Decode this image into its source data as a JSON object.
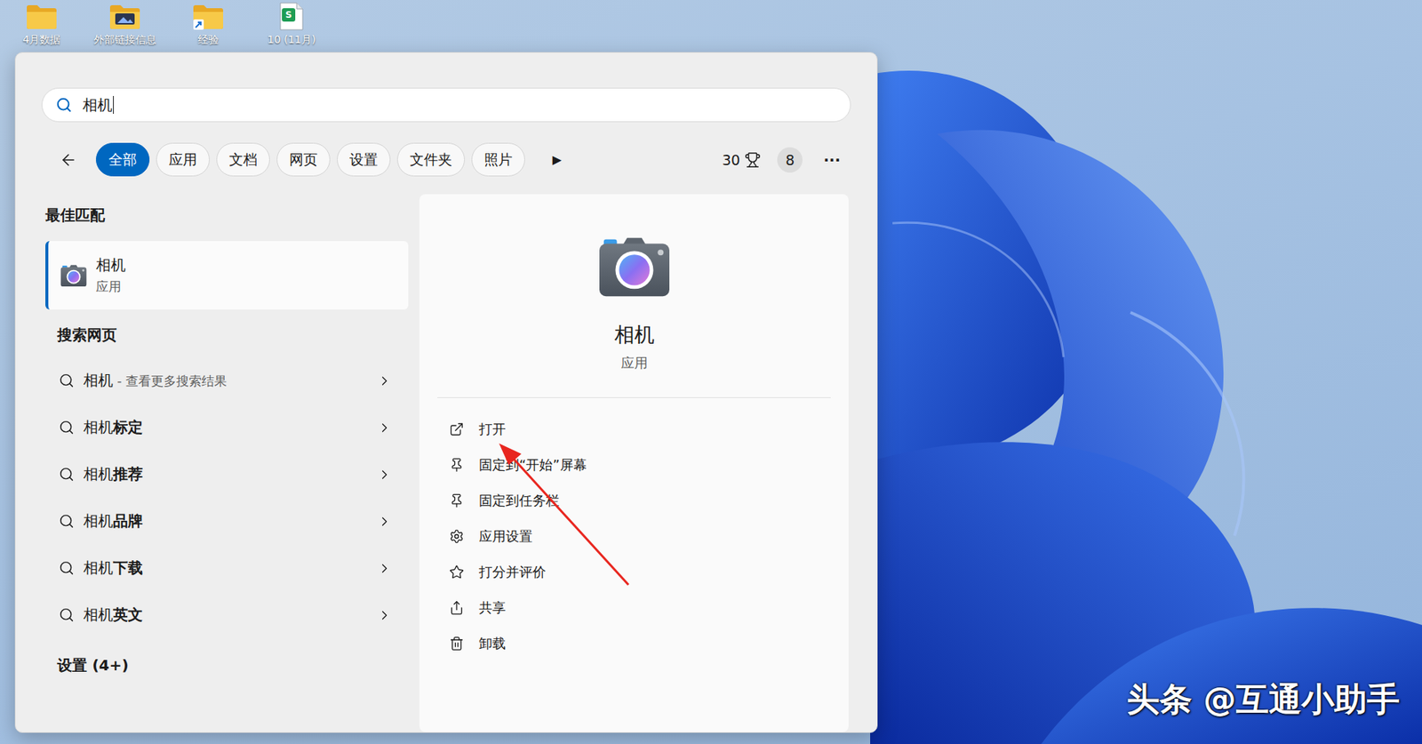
{
  "desktop": {
    "icons": [
      {
        "label": "4月数据",
        "kind": "folder"
      },
      {
        "label": "外部链接信息",
        "kind": "photo-folder"
      },
      {
        "label": "经验",
        "kind": "shortcut-folder"
      },
      {
        "label": "10 (11月)",
        "kind": "sheet",
        "badge": "S"
      }
    ]
  },
  "search": {
    "query": "相机"
  },
  "filters": [
    {
      "label": "全部",
      "selected": true
    },
    {
      "label": "应用",
      "selected": false
    },
    {
      "label": "文档",
      "selected": false
    },
    {
      "label": "网页",
      "selected": false
    },
    {
      "label": "设置",
      "selected": false
    },
    {
      "label": "文件夹",
      "selected": false
    },
    {
      "label": "照片",
      "selected": false
    }
  ],
  "play": "▶",
  "points": "30",
  "badge": "8",
  "more": "···",
  "best_match": {
    "heading": "最佳匹配",
    "title": "相机",
    "subtitle": "应用",
    "selected": true
  },
  "web": {
    "heading": "搜索网页",
    "items": [
      {
        "prefix": "相机",
        "rest": " - 查看更多搜索结果",
        "kind": "more"
      },
      {
        "prefix": "相机",
        "rest": "标定",
        "kind": "suggestion"
      },
      {
        "prefix": "相机",
        "rest": "推荐",
        "kind": "suggestion"
      },
      {
        "prefix": "相机",
        "rest": "品牌",
        "kind": "suggestion"
      },
      {
        "prefix": "相机",
        "rest": "下载",
        "kind": "suggestion"
      },
      {
        "prefix": "相机",
        "rest": "英文",
        "kind": "suggestion"
      }
    ]
  },
  "settings": {
    "heading": "设置 (4+)"
  },
  "detail": {
    "title": "相机",
    "subtitle": "应用",
    "actions": [
      {
        "label": "打开",
        "kind": "open"
      },
      {
        "label": "固定到“开始”屏幕",
        "kind": "pin"
      },
      {
        "label": "固定到任务栏",
        "kind": "pin"
      },
      {
        "label": "应用设置",
        "kind": "settings"
      },
      {
        "label": "打分并评价",
        "kind": "rate"
      },
      {
        "label": "共享",
        "kind": "share"
      },
      {
        "label": "卸载",
        "kind": "uninstall"
      }
    ]
  },
  "watermark": "头条 @互通小助手"
}
